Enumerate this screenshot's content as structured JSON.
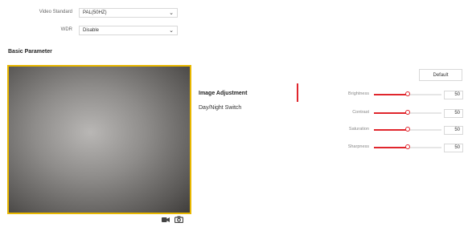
{
  "form": {
    "video_standard": {
      "label": "Video Standard",
      "value": "PAL(50HZ)"
    },
    "wdr": {
      "label": "WDR",
      "value": "Disable"
    }
  },
  "section": {
    "title": "Basic Parameter"
  },
  "preview": {
    "record_icon": "video-camera-icon",
    "snapshot_icon": "camera-icon"
  },
  "tabs": [
    {
      "label": "Image Adjustment",
      "active": true
    },
    {
      "label": "Day/Night Switch",
      "active": false
    }
  ],
  "default_button": {
    "label": "Default"
  },
  "sliders": [
    {
      "label": "Brightness",
      "value": "50",
      "level": 0.5
    },
    {
      "label": "Contrast",
      "value": "50",
      "level": 0.5
    },
    {
      "label": "Saturation",
      "value": "50",
      "level": 0.5
    },
    {
      "label": "Sharpness",
      "value": "50",
      "level": 0.5
    }
  ],
  "colors": {
    "accent": "#e0262d",
    "preview_border": "#e8b700"
  }
}
